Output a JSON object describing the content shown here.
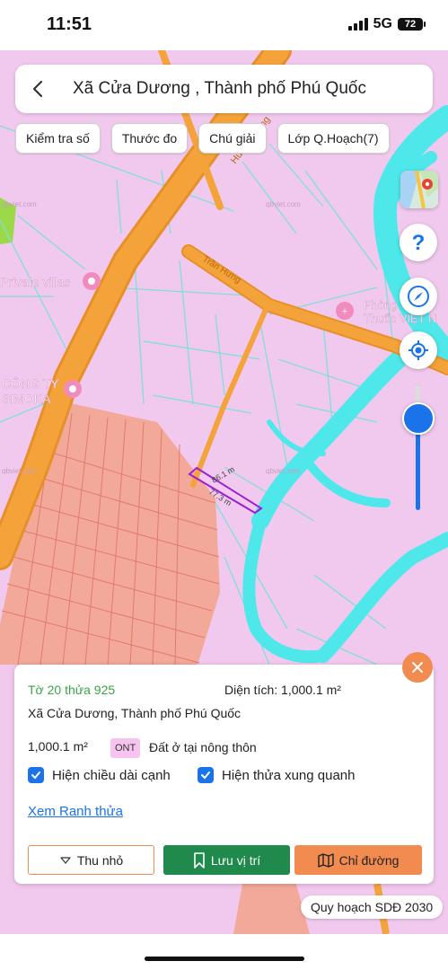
{
  "status_bar": {
    "time": "11:51",
    "network": "5G",
    "battery": "72"
  },
  "header": {
    "title": "Xã Cửa Dương , Thành phố Phú Quốc"
  },
  "toolbar": {
    "chips": [
      "Kiểm tra số",
      "Thước đo",
      "Chú giải",
      "Lớp Q.Hoạch(7)"
    ]
  },
  "map": {
    "colors": {
      "residential": "#f2c9ee",
      "water": "#4ee8ea",
      "road": "#f4a33a",
      "agriculture": "#f2a99a",
      "parcel_line": "#7fdfdc",
      "selected_parcel": "#9d1fd0",
      "green": "#9bd94a"
    },
    "labels": {
      "private_villas": "Private villas",
      "company": "CÔNG TY",
      "company2": "SIMOKA",
      "pharmacy": "Phòng",
      "pharmacy2": "Thuốc VIỆT N",
      "road_name": "Hùng Vương",
      "road_name2": "Trần Hưng",
      "edge_1": "86.1 m",
      "edge_2": "77.3 m",
      "watermark": "qbviet.com"
    },
    "icons": {
      "map_type": "map-layer-icon",
      "help": "question-icon",
      "compass": "compass-icon",
      "locate": "locate-icon"
    },
    "zoom_level": 0.85
  },
  "parcel": {
    "id": "Tờ 20 thửa 925",
    "area_label": "Diện tích: 1,000.1 m²",
    "address": "Xã Cửa Dương, Thành phố Phú Quốc",
    "area_value": "1,000.1 m²",
    "land_code": "ONT",
    "land_type": "Đất ở tại nông thôn",
    "show_edges_label": "Hiện chiều dài cạnh",
    "show_edges_checked": true,
    "show_neighbors_label": "Hiện thửa xung quanh",
    "show_neighbors_checked": true,
    "view_boundary": "Xem Ranh thửa",
    "buttons": {
      "collapse": "Thu nhỏ",
      "save": "Lưu vị trí",
      "directions": "Chỉ đường"
    }
  },
  "plan_badge": "Quy hoạch SDĐ 2030"
}
